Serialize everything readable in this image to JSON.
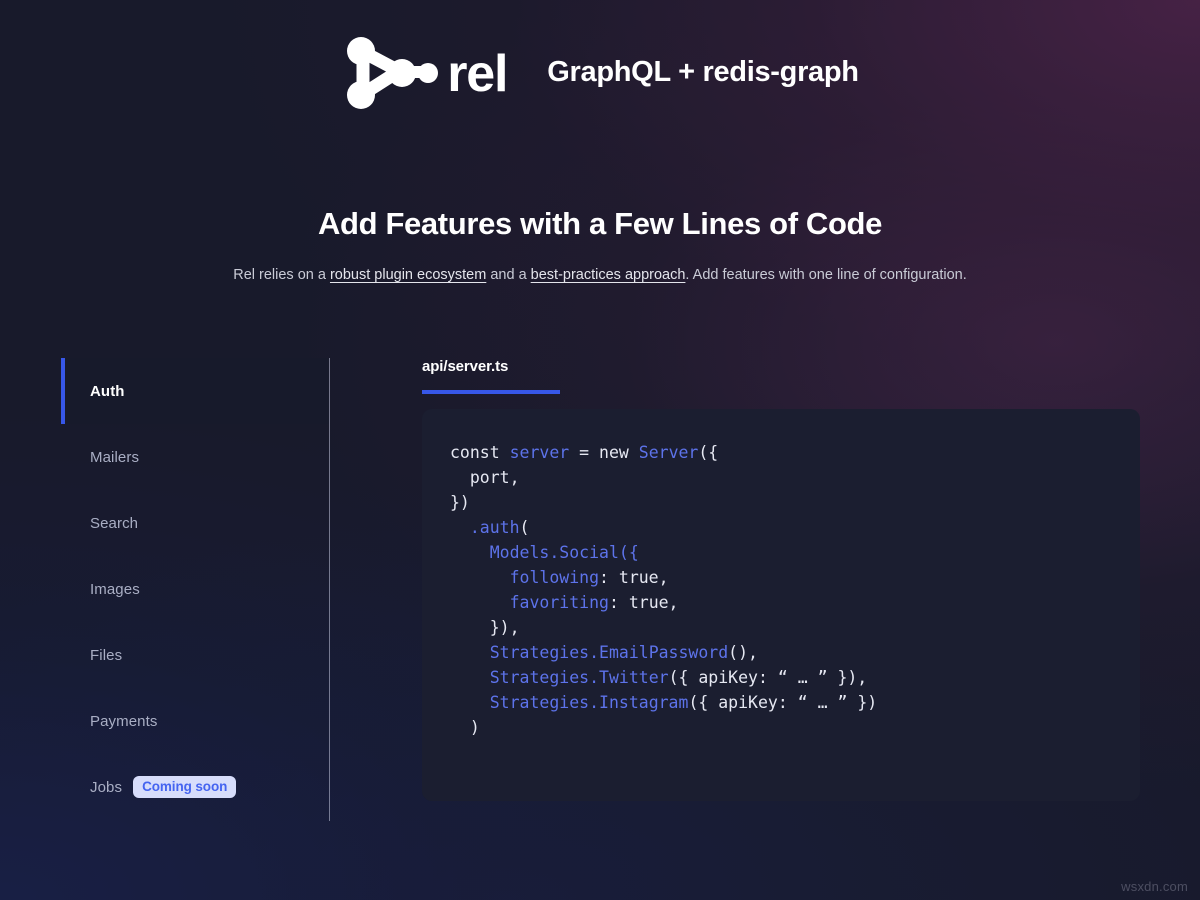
{
  "brand": {
    "logo_icon": "rel-graph-logo-icon",
    "wordmark": "rel",
    "tagline": "GraphQL + redis-graph"
  },
  "hero": {
    "title": "Add Features with a Few Lines of Code",
    "subtitle_parts": {
      "lead": "Rel relies on a ",
      "link1": "robust plugin ecosystem",
      "mid": " and a ",
      "link2": "best-practices approach",
      "tail": ". Add features with one line of configuration."
    }
  },
  "sidebar": {
    "items": [
      {
        "label": "Auth",
        "active": true,
        "badge": null
      },
      {
        "label": "Mailers",
        "active": false,
        "badge": null
      },
      {
        "label": "Search",
        "active": false,
        "badge": null
      },
      {
        "label": "Images",
        "active": false,
        "badge": null
      },
      {
        "label": "Files",
        "active": false,
        "badge": null
      },
      {
        "label": "Payments",
        "active": false,
        "badge": null
      },
      {
        "label": "Jobs",
        "active": false,
        "badge": "Coming soon"
      }
    ]
  },
  "panel": {
    "tabs": [
      {
        "label": "api/server.ts",
        "active": true
      }
    ],
    "code_lines": [
      [
        {
          "t": "const ",
          "c": "kw"
        },
        {
          "t": "server",
          "c": "id"
        },
        {
          "t": " = new ",
          "c": "kw"
        },
        {
          "t": "Server",
          "c": "id"
        },
        {
          "t": "({",
          "c": "pn"
        }
      ],
      [
        {
          "t": "  port,",
          "c": "kw"
        }
      ],
      [
        {
          "t": "})",
          "c": "pn"
        }
      ],
      [
        {
          "t": "  ",
          "c": "kw"
        },
        {
          "t": ".auth",
          "c": "id"
        },
        {
          "t": "(",
          "c": "pn"
        }
      ],
      [
        {
          "t": "    ",
          "c": "kw"
        },
        {
          "t": "Models.Social",
          "c": "id"
        },
        {
          "t": "({",
          "c": "id"
        }
      ],
      [
        {
          "t": "      ",
          "c": "kw"
        },
        {
          "t": "following",
          "c": "id"
        },
        {
          "t": ": true,",
          "c": "kw"
        }
      ],
      [
        {
          "t": "      ",
          "c": "kw"
        },
        {
          "t": "favoriting",
          "c": "id"
        },
        {
          "t": ": true,",
          "c": "kw"
        }
      ],
      [
        {
          "t": "    }),",
          "c": "pn"
        }
      ],
      [
        {
          "t": "    ",
          "c": "kw"
        },
        {
          "t": "Strategies.EmailPassword",
          "c": "id"
        },
        {
          "t": "(),",
          "c": "pn"
        }
      ],
      [
        {
          "t": "    ",
          "c": "kw"
        },
        {
          "t": "Strategies.Twitter",
          "c": "id"
        },
        {
          "t": "({ apiKey: “ … ” }),",
          "c": "pn"
        }
      ],
      [
        {
          "t": "    ",
          "c": "kw"
        },
        {
          "t": "Strategies.Instagram",
          "c": "id"
        },
        {
          "t": "({ apiKey: “ … ” })",
          "c": "pn"
        }
      ],
      [
        {
          "t": "  )",
          "c": "pn"
        }
      ]
    ]
  },
  "watermark": "wsxdn.com",
  "colors": {
    "accent_blue": "#3757E8",
    "code_identifier_blue": "#5D73EA",
    "badge_bg": "#D7DDFB",
    "badge_text": "#4564F0",
    "code_bg": "#1B1E30",
    "page_bg": "#181A2B"
  }
}
